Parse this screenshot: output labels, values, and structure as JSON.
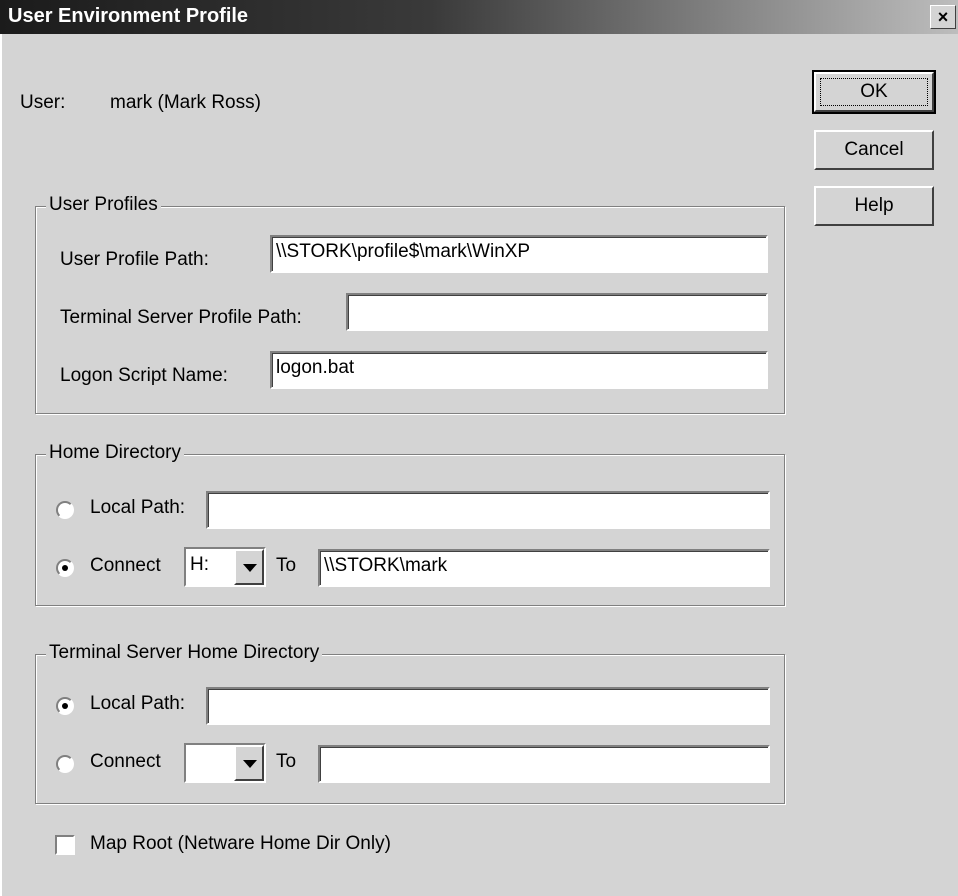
{
  "window": {
    "title": "User Environment Profile",
    "close_glyph": "×"
  },
  "user": {
    "label": "User:",
    "value": "mark (Mark Ross)"
  },
  "buttons": {
    "ok": "OK",
    "cancel": "Cancel",
    "help": "Help"
  },
  "user_profiles": {
    "legend": "User Profiles",
    "profile_path_label": "User Profile Path:",
    "profile_path_value": "\\\\STORK\\profile$\\mark\\WinXP",
    "ts_profile_path_label": "Terminal Server Profile Path:",
    "ts_profile_path_value": "",
    "logon_script_label": "Logon Script Name:",
    "logon_script_value": "logon.bat"
  },
  "home_directory": {
    "legend": "Home Directory",
    "local_path_label": "Local Path:",
    "local_path_value": "",
    "local_path_selected": false,
    "connect_label": "Connect",
    "connect_selected": true,
    "drive_value": "H:",
    "to_label": "To",
    "connect_path_value": "\\\\STORK\\mark"
  },
  "ts_home_directory": {
    "legend": "Terminal Server Home Directory",
    "local_path_label": "Local Path:",
    "local_path_value": "",
    "local_path_selected": true,
    "connect_label": "Connect",
    "connect_selected": false,
    "drive_value": "",
    "to_label": "To",
    "connect_path_value": ""
  },
  "map_root": {
    "label": "Map Root (Netware Home Dir Only)",
    "checked": false
  },
  "icons": {
    "close": "close-icon",
    "dropdown": "chevron-down-icon"
  }
}
